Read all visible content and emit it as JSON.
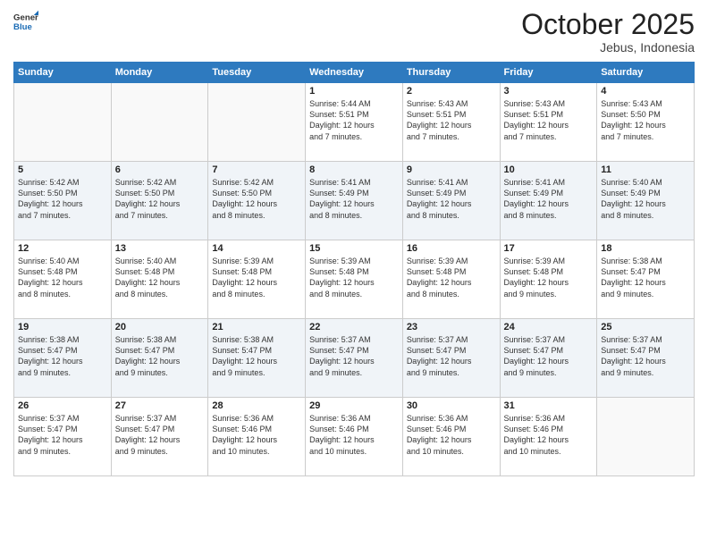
{
  "header": {
    "logo_general": "General",
    "logo_blue": "Blue",
    "month": "October 2025",
    "location": "Jebus, Indonesia"
  },
  "days_of_week": [
    "Sunday",
    "Monday",
    "Tuesday",
    "Wednesday",
    "Thursday",
    "Friday",
    "Saturday"
  ],
  "weeks": [
    [
      {
        "num": "",
        "info": ""
      },
      {
        "num": "",
        "info": ""
      },
      {
        "num": "",
        "info": ""
      },
      {
        "num": "1",
        "info": "Sunrise: 5:44 AM\nSunset: 5:51 PM\nDaylight: 12 hours\nand 7 minutes."
      },
      {
        "num": "2",
        "info": "Sunrise: 5:43 AM\nSunset: 5:51 PM\nDaylight: 12 hours\nand 7 minutes."
      },
      {
        "num": "3",
        "info": "Sunrise: 5:43 AM\nSunset: 5:51 PM\nDaylight: 12 hours\nand 7 minutes."
      },
      {
        "num": "4",
        "info": "Sunrise: 5:43 AM\nSunset: 5:50 PM\nDaylight: 12 hours\nand 7 minutes."
      }
    ],
    [
      {
        "num": "5",
        "info": "Sunrise: 5:42 AM\nSunset: 5:50 PM\nDaylight: 12 hours\nand 7 minutes."
      },
      {
        "num": "6",
        "info": "Sunrise: 5:42 AM\nSunset: 5:50 PM\nDaylight: 12 hours\nand 7 minutes."
      },
      {
        "num": "7",
        "info": "Sunrise: 5:42 AM\nSunset: 5:50 PM\nDaylight: 12 hours\nand 8 minutes."
      },
      {
        "num": "8",
        "info": "Sunrise: 5:41 AM\nSunset: 5:49 PM\nDaylight: 12 hours\nand 8 minutes."
      },
      {
        "num": "9",
        "info": "Sunrise: 5:41 AM\nSunset: 5:49 PM\nDaylight: 12 hours\nand 8 minutes."
      },
      {
        "num": "10",
        "info": "Sunrise: 5:41 AM\nSunset: 5:49 PM\nDaylight: 12 hours\nand 8 minutes."
      },
      {
        "num": "11",
        "info": "Sunrise: 5:40 AM\nSunset: 5:49 PM\nDaylight: 12 hours\nand 8 minutes."
      }
    ],
    [
      {
        "num": "12",
        "info": "Sunrise: 5:40 AM\nSunset: 5:48 PM\nDaylight: 12 hours\nand 8 minutes."
      },
      {
        "num": "13",
        "info": "Sunrise: 5:40 AM\nSunset: 5:48 PM\nDaylight: 12 hours\nand 8 minutes."
      },
      {
        "num": "14",
        "info": "Sunrise: 5:39 AM\nSunset: 5:48 PM\nDaylight: 12 hours\nand 8 minutes."
      },
      {
        "num": "15",
        "info": "Sunrise: 5:39 AM\nSunset: 5:48 PM\nDaylight: 12 hours\nand 8 minutes."
      },
      {
        "num": "16",
        "info": "Sunrise: 5:39 AM\nSunset: 5:48 PM\nDaylight: 12 hours\nand 8 minutes."
      },
      {
        "num": "17",
        "info": "Sunrise: 5:39 AM\nSunset: 5:48 PM\nDaylight: 12 hours\nand 9 minutes."
      },
      {
        "num": "18",
        "info": "Sunrise: 5:38 AM\nSunset: 5:47 PM\nDaylight: 12 hours\nand 9 minutes."
      }
    ],
    [
      {
        "num": "19",
        "info": "Sunrise: 5:38 AM\nSunset: 5:47 PM\nDaylight: 12 hours\nand 9 minutes."
      },
      {
        "num": "20",
        "info": "Sunrise: 5:38 AM\nSunset: 5:47 PM\nDaylight: 12 hours\nand 9 minutes."
      },
      {
        "num": "21",
        "info": "Sunrise: 5:38 AM\nSunset: 5:47 PM\nDaylight: 12 hours\nand 9 minutes."
      },
      {
        "num": "22",
        "info": "Sunrise: 5:37 AM\nSunset: 5:47 PM\nDaylight: 12 hours\nand 9 minutes."
      },
      {
        "num": "23",
        "info": "Sunrise: 5:37 AM\nSunset: 5:47 PM\nDaylight: 12 hours\nand 9 minutes."
      },
      {
        "num": "24",
        "info": "Sunrise: 5:37 AM\nSunset: 5:47 PM\nDaylight: 12 hours\nand 9 minutes."
      },
      {
        "num": "25",
        "info": "Sunrise: 5:37 AM\nSunset: 5:47 PM\nDaylight: 12 hours\nand 9 minutes."
      }
    ],
    [
      {
        "num": "26",
        "info": "Sunrise: 5:37 AM\nSunset: 5:47 PM\nDaylight: 12 hours\nand 9 minutes."
      },
      {
        "num": "27",
        "info": "Sunrise: 5:37 AM\nSunset: 5:47 PM\nDaylight: 12 hours\nand 9 minutes."
      },
      {
        "num": "28",
        "info": "Sunrise: 5:36 AM\nSunset: 5:46 PM\nDaylight: 12 hours\nand 10 minutes."
      },
      {
        "num": "29",
        "info": "Sunrise: 5:36 AM\nSunset: 5:46 PM\nDaylight: 12 hours\nand 10 minutes."
      },
      {
        "num": "30",
        "info": "Sunrise: 5:36 AM\nSunset: 5:46 PM\nDaylight: 12 hours\nand 10 minutes."
      },
      {
        "num": "31",
        "info": "Sunrise: 5:36 AM\nSunset: 5:46 PM\nDaylight: 12 hours\nand 10 minutes."
      },
      {
        "num": "",
        "info": ""
      }
    ]
  ]
}
